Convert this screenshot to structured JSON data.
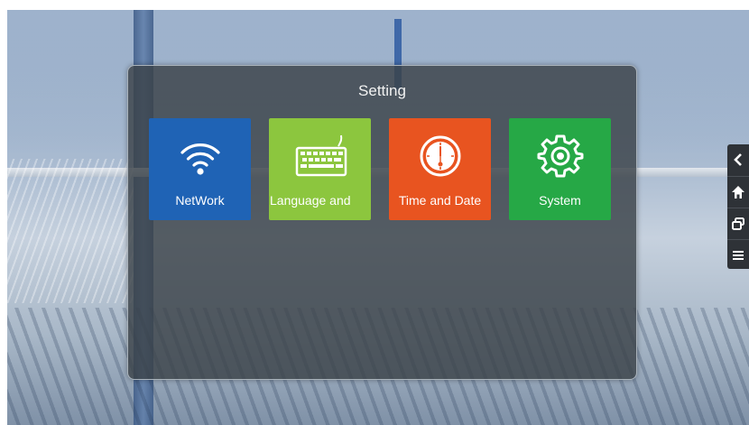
{
  "dialog": {
    "title": "Setting",
    "tiles": [
      {
        "label": "NetWork",
        "icon": "wifi-icon",
        "color": "#1f63b5"
      },
      {
        "label": "Language and",
        "icon": "keyboard-icon",
        "color": "#8cc63e"
      },
      {
        "label": "Time and Date",
        "icon": "clock-icon",
        "color": "#e85420"
      },
      {
        "label": "System",
        "icon": "gear-icon",
        "color": "#26a846"
      }
    ]
  },
  "sidebar": {
    "buttons": [
      {
        "icon": "back-chevron-icon"
      },
      {
        "icon": "home-icon"
      },
      {
        "icon": "recent-apps-icon"
      },
      {
        "icon": "menu-icon"
      }
    ]
  }
}
